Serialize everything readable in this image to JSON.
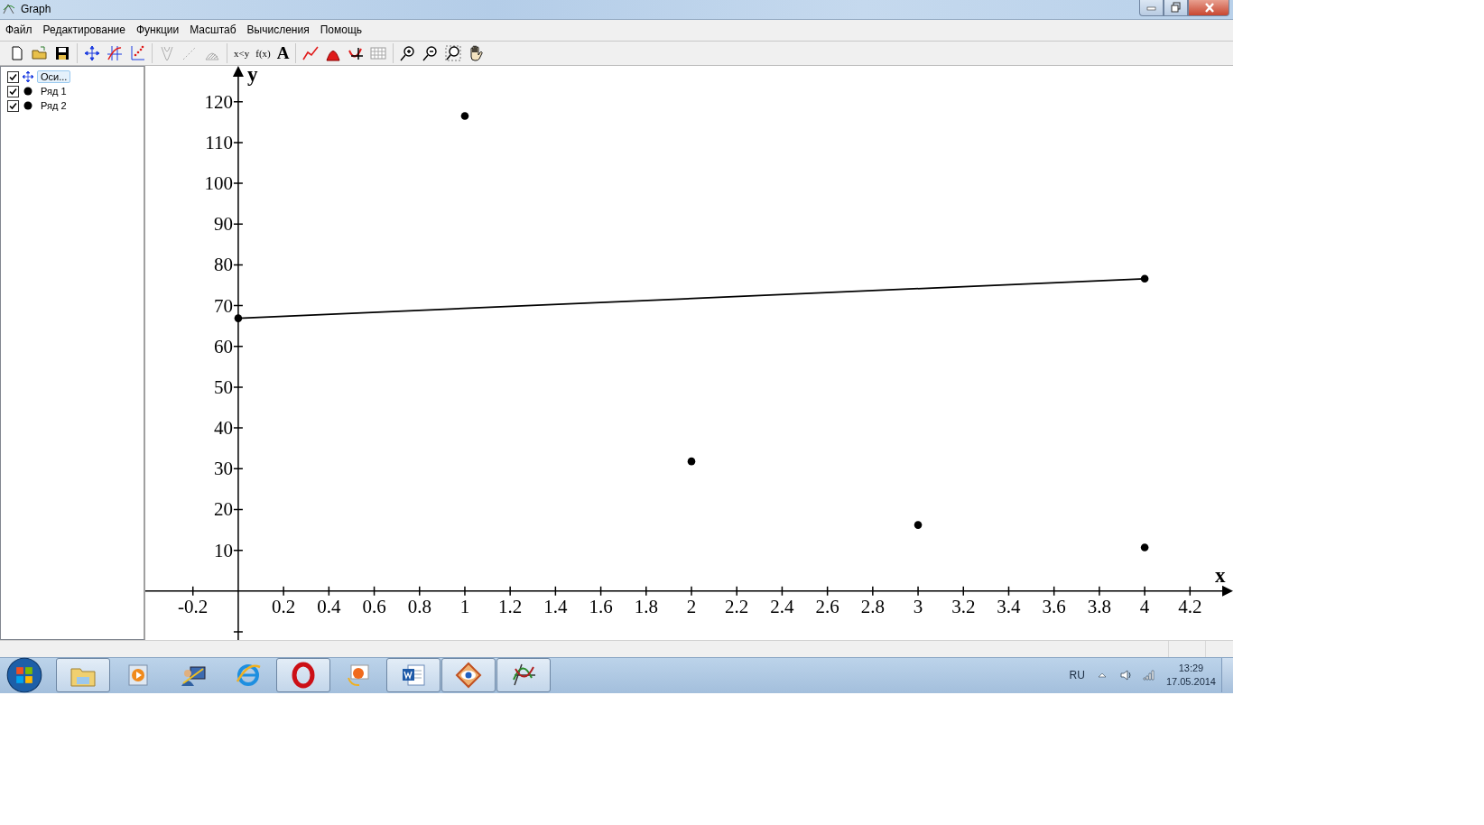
{
  "window": {
    "title": "Graph"
  },
  "menu": [
    {
      "label": "Файл"
    },
    {
      "label": "Редактирование"
    },
    {
      "label": "Функции"
    },
    {
      "label": "Масштаб"
    },
    {
      "label": "Вычисления"
    },
    {
      "label": "Помощь"
    }
  ],
  "toolbar": [
    {
      "buttons": [
        {
          "disabled": false
        },
        {
          "disabled": false
        },
        {
          "disabled": false
        }
      ]
    },
    {
      "buttons": [
        {
          "disabled": false
        },
        {
          "disabled": false
        },
        {
          "disabled": false
        }
      ]
    },
    {
      "buttons": [
        {
          "disabled": true
        },
        {
          "disabled": true
        },
        {
          "disabled": true
        }
      ]
    },
    {
      "buttons": [
        {
          "disabled": false,
          "label": "x<y"
        },
        {
          "disabled": false,
          "label": "f(x)"
        },
        {
          "disabled": false,
          "label": "A"
        }
      ]
    },
    {
      "buttons": [
        {
          "disabled": false
        },
        {
          "disabled": false
        },
        {
          "disabled": false
        },
        {
          "disabled": false
        }
      ]
    },
    {
      "buttons": [
        {
          "disabled": false
        },
        {
          "disabled": false
        },
        {
          "disabled": false
        },
        {
          "disabled": false
        }
      ]
    }
  ],
  "tree": [
    {
      "kind": "axes",
      "label": "Оси...",
      "checked": true,
      "selected": true
    },
    {
      "kind": "series",
      "checked": true,
      "selected": false
    },
    {
      "kind": "series",
      "checked": true,
      "selected": false
    }
  ],
  "plot": {
    "chart_data": {
      "type": "scatter",
      "xlabel": "x",
      "ylabel": "y",
      "x": [
        0,
        1,
        2,
        3,
        4
      ],
      "series": [
        {
          "name": "Ряд 1",
          "color": "#000000",
          "values": [
            null,
            116.5,
            31.8,
            16.2,
            10.7
          ]
        },
        {
          "name": "Ряд 2",
          "type": "line",
          "marker": "circle",
          "color": "#000000",
          "values": [
            66.9,
            null,
            null,
            null,
            76.6
          ]
        }
      ],
      "xlim": [
        -0.41,
        4.39
      ],
      "ylim": [
        -12,
        128.8
      ],
      "xticks": [
        -0.2,
        0.2,
        0.4,
        0.6,
        0.8,
        1,
        1.2,
        1.4,
        1.6,
        1.8,
        2,
        2.2,
        2.4,
        2.6,
        2.8,
        3,
        3.2,
        3.4,
        3.6,
        3.8,
        4,
        4.2
      ],
      "yticks": [
        10,
        20,
        30,
        40,
        50,
        60,
        70,
        80,
        90,
        100,
        110,
        120
      ]
    }
  },
  "taskbar": {
    "apps": [
      {
        "running": true
      },
      {
        "running": false
      },
      {
        "running": false
      },
      {
        "running": false
      },
      {
        "running": true
      },
      {
        "running": false
      },
      {
        "running": true
      },
      {
        "running": true
      },
      {
        "running": true
      }
    ],
    "language": "RU",
    "time": "13:29",
    "date": "17.05.2014"
  }
}
